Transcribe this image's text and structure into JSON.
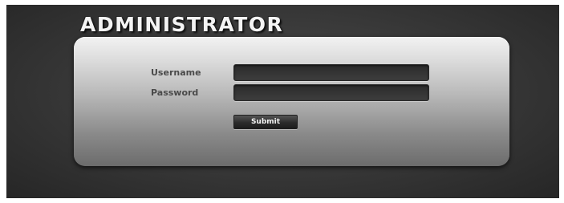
{
  "header": {
    "title": "ADMINISTRATOR"
  },
  "login_form": {
    "username_label": "Username",
    "username_value": "",
    "password_label": "Password",
    "password_value": "",
    "submit_label": "Submit"
  },
  "colors": {
    "background": "#3a3a3a",
    "panel_top": "#f2f2f2",
    "panel_bottom": "#6c6c6c",
    "field": "#333333",
    "button": "#2c2c2c",
    "label_text": "#4a4a4a",
    "title_text": "#f4f4f4"
  }
}
